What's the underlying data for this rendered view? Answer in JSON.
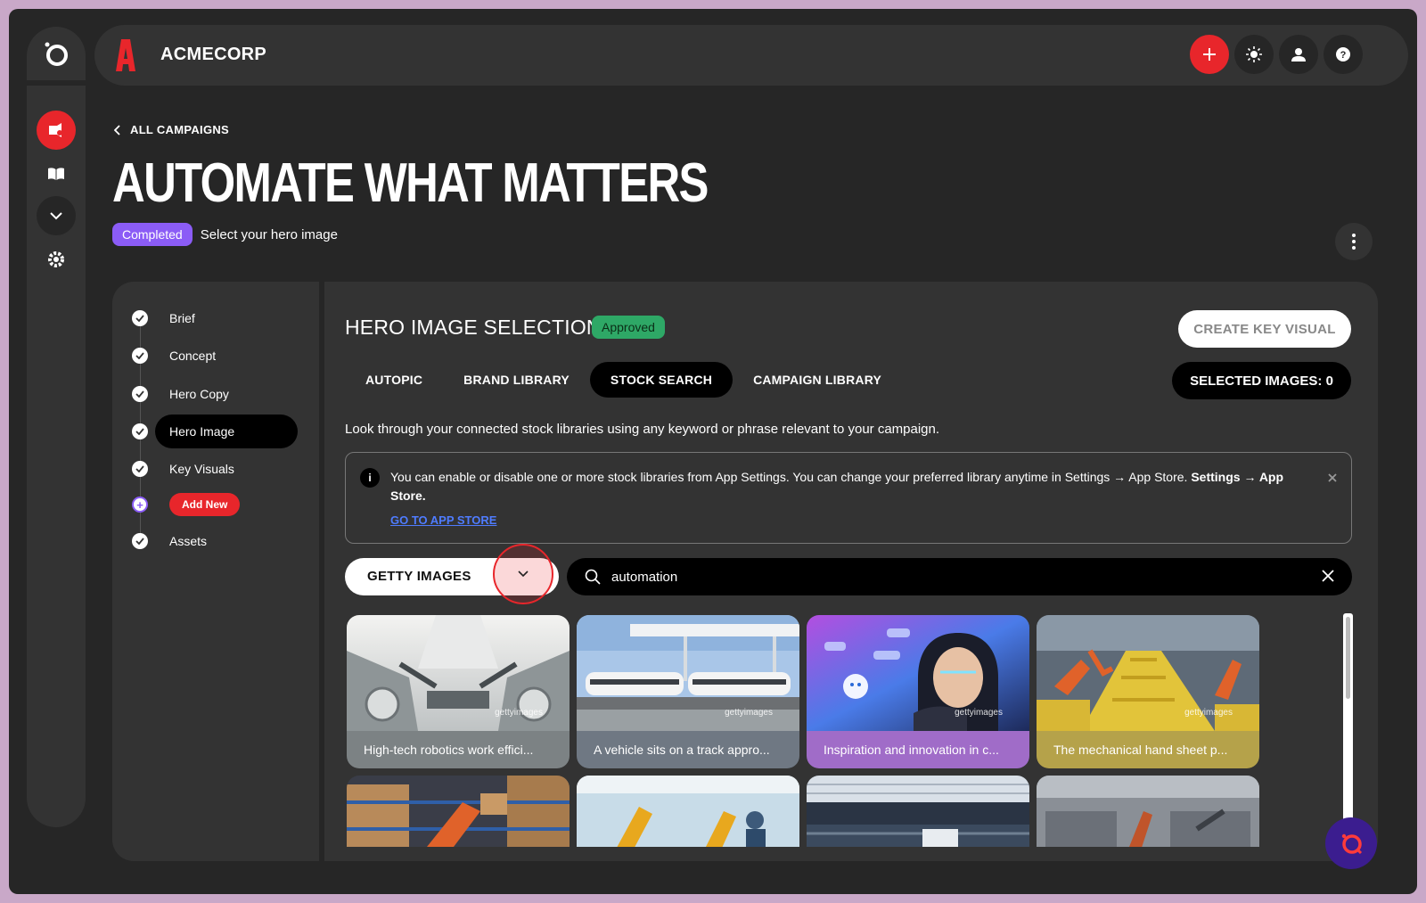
{
  "app": {
    "brand_name": "ACMECORP"
  },
  "header": {
    "back_label": "ALL CAMPAIGNS",
    "title": "AUTOMATE WHAT MATTERS",
    "status_badge": "Completed",
    "status_text": "Select your hero image"
  },
  "steps": [
    {
      "label": "Brief"
    },
    {
      "label": "Concept"
    },
    {
      "label": "Hero Copy"
    },
    {
      "label": "Hero Image"
    },
    {
      "label": "Key Visuals"
    },
    {
      "label": "Add New"
    },
    {
      "label": "Assets"
    }
  ],
  "main": {
    "section_title": "HERO IMAGE SELECTION",
    "approved_badge": "Approved",
    "create_button": "CREATE KEY VISUAL",
    "tabs": [
      {
        "label": "AUTOPIC"
      },
      {
        "label": "BRAND LIBRARY"
      },
      {
        "label": "STOCK SEARCH"
      },
      {
        "label": "CAMPAIGN LIBRARY"
      }
    ],
    "selected_images": "SELECTED IMAGES: 0",
    "description": "Look through your connected stock libraries using any keyword or phrase relevant to your campaign.",
    "info": {
      "icon_label": "i",
      "text_main": "You can enable or disable one or more stock libraries from App Settings. You can change your preferred library anytime in Settings → App Store.",
      "text_bold": "Settings → App Store.",
      "link": "GO TO APP STORE"
    },
    "source_select": "GETTY IMAGES",
    "search_value": "automation",
    "results": [
      {
        "caption": "High-tech robotics work effici...",
        "watermark": "gettyimages"
      },
      {
        "caption": "A vehicle sits on a track appro...",
        "watermark": "gettyimages"
      },
      {
        "caption": "Inspiration and innovation in c...",
        "watermark": "gettyimages"
      },
      {
        "caption": "The mechanical hand sheet p...",
        "watermark": "gettyimages"
      }
    ]
  },
  "colors": {
    "accent_red": "#e8262b",
    "completed_purple": "#8b5cf6",
    "approved_green": "#2ea866",
    "link_blue": "#4f7cff"
  }
}
